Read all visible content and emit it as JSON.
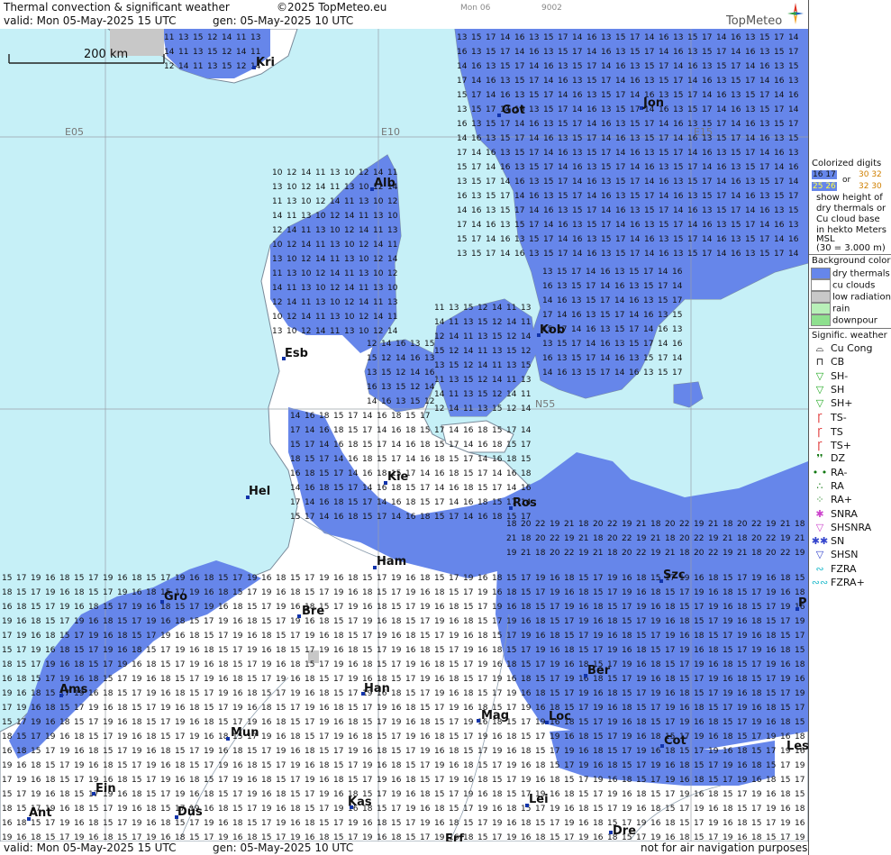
{
  "header": {
    "title": "Thermal convection & significant weather",
    "copyright": "©2025 TopMeteo.eu",
    "day_tag": "Mon 06",
    "code": "9002",
    "valid": "valid:  Mon  05-May-2025  15 UTC",
    "gen": "gen: 05-May-2025 10 UTC",
    "brand": "TopMeteo"
  },
  "footer": {
    "valid": "valid:  Mon  05-May-2025  15 UTC",
    "gen": "gen: 05-May-2025 10 UTC",
    "disclaimer": "not for air navigation purposes"
  },
  "map": {
    "scale_label": "200 km",
    "grid_labels": {
      "e05": "E05",
      "e10": "E10",
      "e15": "E15",
      "n55": "N55"
    },
    "cities": {
      "kri": "Kri",
      "got": "Got",
      "jon": "Jon",
      "alb": "Alb",
      "kob": "Kob",
      "esb": "Esb",
      "kie": "Kie",
      "ros": "Ros",
      "hel": "Hel",
      "ham": "Ham",
      "szc": "Szc",
      "gro": "Gro",
      "bre": "Bre",
      "ber": "Ber",
      "ams": "Ams",
      "han": "Han",
      "mag": "Mag",
      "loc": "Loc",
      "mun": "Mun",
      "cot": "Cot",
      "les": "Les",
      "ein": "Ein",
      "kas": "Kas",
      "lei": "Lei",
      "ant": "Ant",
      "dus": "Düs",
      "dre": "Dre",
      "erf": "Erf",
      "p": "P"
    }
  },
  "legend": {
    "colorized_title": "Colorized digits",
    "sample_a": "16 17",
    "sample_b": "30 32",
    "or": "or",
    "sample_c": "25 26",
    "sample_d": "32 30",
    "desc1": "show height of",
    "desc2": "dry thermals or",
    "desc3": "Cu cloud base",
    "desc4": "in hekto Meters",
    "desc5": "MSL",
    "desc6": "(30 = 3.000 m)",
    "bg_title": "Background color",
    "bg_items": [
      {
        "label": "dry thermals",
        "color": "#6686ea"
      },
      {
        "label": "cu clouds",
        "color": "#ffffff"
      },
      {
        "label": "low radiation",
        "color": "#c8c8c8"
      },
      {
        "label": "rain",
        "color": "#b8f0b8"
      },
      {
        "label": "downpour",
        "color": "#8ee08e"
      }
    ],
    "wx_title": "Signific. weather",
    "wx_items": [
      {
        "label": "Cu Cong",
        "glyph": "⌓",
        "color": "#111111"
      },
      {
        "label": "CB",
        "glyph": "⊓",
        "color": "#111111"
      },
      {
        "label": "SH-",
        "glyph": "▽",
        "color": "#22aa22"
      },
      {
        "label": "SH",
        "glyph": "▽",
        "color": "#22aa22"
      },
      {
        "label": "SH+",
        "glyph": "▽",
        "color": "#22aa22"
      },
      {
        "label": "TS-",
        "glyph": "Ꞅ",
        "color": "#dd2222"
      },
      {
        "label": "TS",
        "glyph": "Ꞅ",
        "color": "#dd2222"
      },
      {
        "label": "TS+",
        "glyph": "Ꞅ",
        "color": "#dd2222"
      },
      {
        "label": "DZ",
        "glyph": "❜❜",
        "color": "#117711"
      },
      {
        "label": "RA-",
        "glyph": "• •",
        "color": "#117711"
      },
      {
        "label": "RA",
        "glyph": "∴",
        "color": "#117711"
      },
      {
        "label": "RA+",
        "glyph": "⁘",
        "color": "#117711"
      },
      {
        "label": "SNRA",
        "glyph": "✱",
        "color": "#cc44cc"
      },
      {
        "label": "SHSNRA",
        "glyph": "▽",
        "color": "#cc44cc"
      },
      {
        "label": "SN",
        "glyph": "✱✱",
        "color": "#3344cc"
      },
      {
        "label": "SHSN",
        "glyph": "▽",
        "color": "#3344cc"
      },
      {
        "label": "FZRA",
        "glyph": "∾",
        "color": "#22bbcc"
      },
      {
        "label": "FZRA+",
        "glyph": "∾∾",
        "color": "#22bbcc"
      }
    ]
  },
  "colors": {
    "sea": "#c6f0f7",
    "dry_thermals": "#6686ea",
    "cu_land": "#ffffff",
    "low_radiation": "#c8c8c8"
  }
}
